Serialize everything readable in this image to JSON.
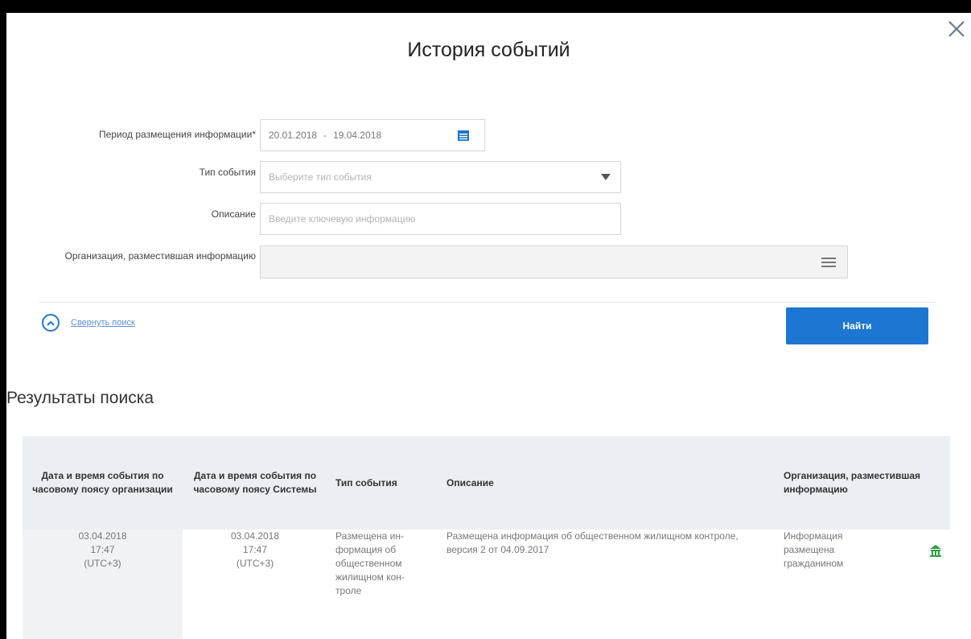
{
  "dialog": {
    "title": "История событий",
    "close_icon": "close-icon"
  },
  "form": {
    "period_label": "Период размещения информации*",
    "period_from": "20.01.2018",
    "period_separator": "-",
    "period_to": "19.04.2018",
    "calendar_icon": "calendar-icon",
    "event_type_label": "Тип события",
    "event_type_placeholder": "Выберите тип события",
    "description_label": "Описание",
    "description_placeholder": "Введите ключевую информацию",
    "organization_label": "Организация, разместившая информацию",
    "organization_value": "",
    "list_icon": "list-icon"
  },
  "actions": {
    "collapse_label": "Свернуть поиск",
    "find_label": "Найти"
  },
  "results": {
    "heading": "Результаты поиска",
    "columns": [
      "Дата и время события по часовому поясу организации",
      "Дата и время события по часовому поясу Системы",
      "Тип события",
      "Описание",
      "Организация, разместившая информацию"
    ],
    "rows": [
      {
        "org_time_date": "03.04.2018",
        "org_time_time": "17:47",
        "org_time_zone": "(UTC+3)",
        "sys_time_date": "03.04.2018",
        "sys_time_time": "17:47",
        "sys_time_zone": "(UTC+3)",
        "event_type": "Размещена ин-формация об общественном жилищном кон-троле",
        "description": "Размещена информация об общественном жилищном контроле, версия 2 от 04.09.2017",
        "organization": "Информация размещена гражданином",
        "org_icon": "house-icon"
      }
    ]
  },
  "colors": {
    "accent": "#1d76d1",
    "link": "#5a8fd6",
    "header_bg": "#ebeef2",
    "house_icon": "#2f9e44"
  }
}
